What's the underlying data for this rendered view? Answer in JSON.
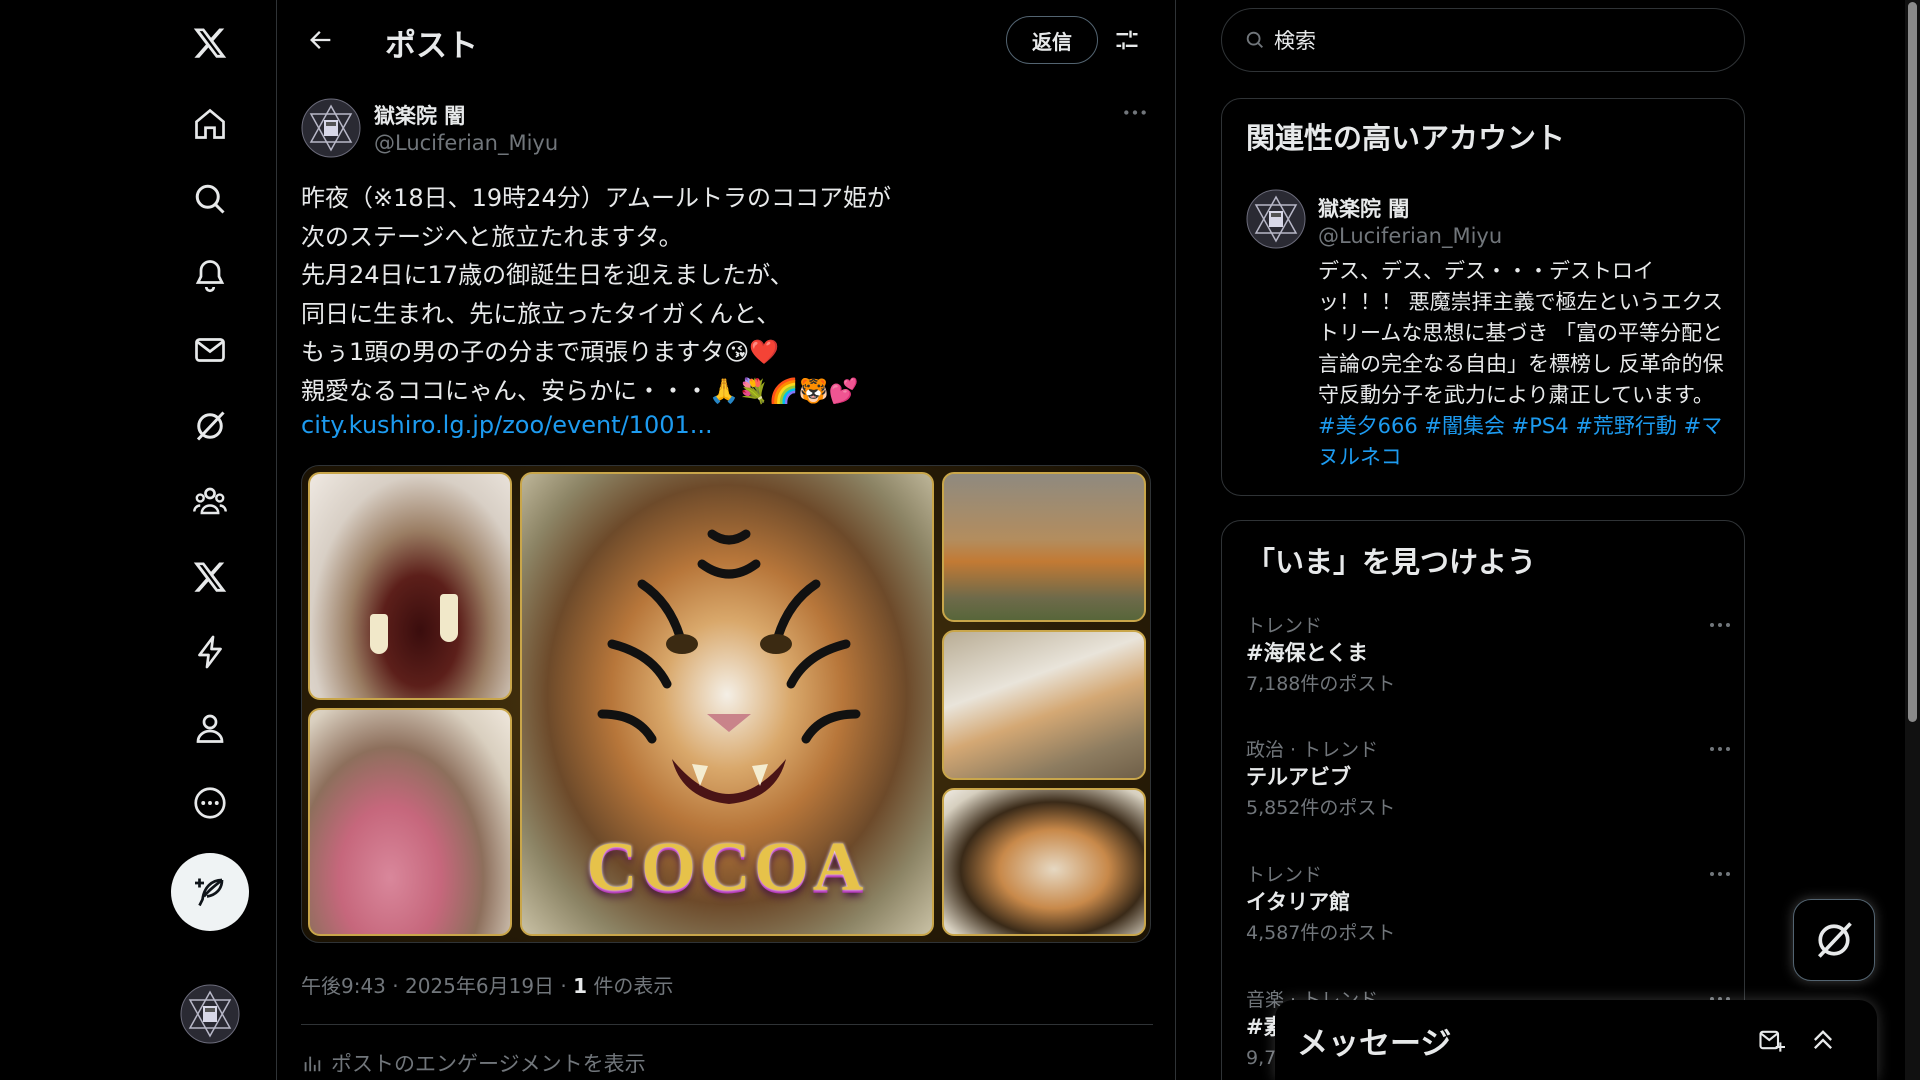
{
  "nav": {
    "items": [
      {
        "name": "x-logo-icon"
      },
      {
        "name": "home-icon"
      },
      {
        "name": "search-icon"
      },
      {
        "name": "notifications-icon"
      },
      {
        "name": "messages-icon"
      },
      {
        "name": "grok-icon"
      },
      {
        "name": "communities-icon"
      },
      {
        "name": "premium-icon"
      },
      {
        "name": "verified-orgs-icon"
      },
      {
        "name": "profile-icon"
      },
      {
        "name": "more-icon"
      }
    ],
    "compose_icon": "feather-plus-icon"
  },
  "header": {
    "title": "ポスト",
    "reply_label": "返信"
  },
  "post": {
    "author_name": "獄楽院 闇",
    "author_handle": "@Luciferian_Miyu",
    "text": "昨夜（※18日、19時24分）アムールトラのココア姫が\n次のステージへと旅立たれますタ。\n先月24日に17歳の御誕生日を迎えましたが、\n同日に生まれ、先に旅立ったタイガくんと、\nもぅ1頭の男の子の分まで頑張りますタ😘❤️\n親愛なるココにゃん、安らかに・・・🙏💐🌈🐯💕",
    "link": "city.kushiro.lg.jp/zoo/event/1001...",
    "image_caption": "COCOA",
    "meta_time": "午後9:43 · 2025年6月19日 · ",
    "views_count": "1",
    "views_label": " 件の表示",
    "engagement_label": "ポストのエンゲージメントを表示"
  },
  "search": {
    "placeholder": "検索"
  },
  "related": {
    "title": "関連性の高いアカウント",
    "name": "獄楽院 闇",
    "handle": "@Luciferian_Miyu",
    "bio": "デス、デス、デス・・・デストロイッ！！！ 悪魔崇拝主義で極左というエクストリームな思想に基づき 「富の平等分配と言論の完全なる自由」を標榜し 反革命的保守反動分子を武力により粛正しています。",
    "tags": [
      "#美夕666",
      "#闇集会",
      "#PS4",
      "#荒野行動",
      "#マヌルネコ"
    ]
  },
  "trends": {
    "title": "「いま」を見つけよう",
    "items": [
      {
        "category": "トレンド",
        "name": "#海保とくま",
        "count": "7,188件のポスト"
      },
      {
        "category": "政治 · トレンド",
        "name": "テルアビブ",
        "count": "5,852件のポスト"
      },
      {
        "category": "トレンド",
        "name": "イタリア館",
        "count": "4,587件のポスト"
      },
      {
        "category": "音楽 · トレンド",
        "name": "#素",
        "count": "9,7"
      }
    ]
  },
  "messages": {
    "title": "メッセージ"
  },
  "colors": {
    "background": "#000000",
    "text": "#e7e9ea",
    "muted": "#71767b",
    "link": "#1d9bf0",
    "border": "#2f3336"
  }
}
